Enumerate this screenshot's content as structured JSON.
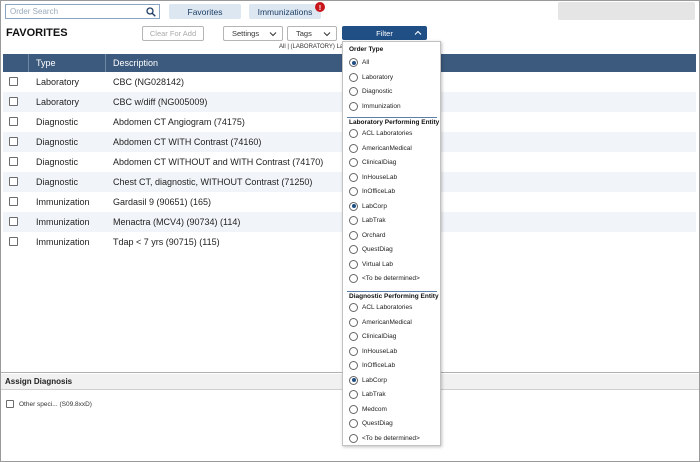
{
  "search": {
    "placeholder": "Order Search"
  },
  "tabs": [
    {
      "label": "Favorites"
    },
    {
      "label": "Immunizations",
      "badge": "!"
    }
  ],
  "page_title": "FAVORITES",
  "toolbar": {
    "clear_label": "Clear For Add",
    "settings_label": "Settings",
    "tags_label": "Tags",
    "filter_label": "Filter",
    "filter_summary": "All | (LABORATORY) La"
  },
  "table": {
    "columns": [
      "Type",
      "Description"
    ],
    "rows": [
      {
        "type": "Laboratory",
        "description": "CBC (NG028142)"
      },
      {
        "type": "Laboratory",
        "description": "CBC w/diff (NG005009)"
      },
      {
        "type": "Diagnostic",
        "description": "Abdomen CT Angiogram (74175)"
      },
      {
        "type": "Diagnostic",
        "description": "Abdomen CT WITH Contrast (74160)"
      },
      {
        "type": "Diagnostic",
        "description": "Abdomen CT WITHOUT and WITH Contrast (74170)"
      },
      {
        "type": "Diagnostic",
        "description": "Chest CT, diagnostic, WITHOUT Contrast (71250)"
      },
      {
        "type": "Immunization",
        "description": "Gardasil 9 (90651) (165)"
      },
      {
        "type": "Immunization",
        "description": "Menactra (MCV4) (90734) (114)"
      },
      {
        "type": "Immunization",
        "description": "Tdap < 7 yrs (90715) (115)"
      }
    ]
  },
  "assign_diagnosis": {
    "title": "Assign Diagnosis",
    "item": "Other speci... (S09.8xxD)"
  },
  "filter_panel": {
    "order_type": {
      "title": "Order Type",
      "options": [
        "All",
        "Laboratory",
        "Diagnostic",
        "Immunization"
      ],
      "selected": "All"
    },
    "lab_entity": {
      "title": "Laboratory Performing Entity",
      "options": [
        "ACL Laboratories",
        "AmericanMedical",
        "ClinicalDiag",
        "InHouseLab",
        "InOfficeLab",
        "LabCorp",
        "LabTrak",
        "Orchard",
        "QuestDiag",
        "Virtual Lab",
        "<To be determined>"
      ],
      "selected": "LabCorp"
    },
    "diag_entity": {
      "title": "Diagnostic Performing Entity",
      "options": [
        "ACL Laboratories",
        "AmericanMedical",
        "ClinicalDiag",
        "InHouseLab",
        "InOfficeLab",
        "LabCorp",
        "LabTrak",
        "Medcom",
        "QuestDiag",
        "<To be determined>"
      ],
      "selected": "LabCorp"
    }
  },
  "colors": {
    "header_blue": "#3c5a7d",
    "filter_blue": "#1f4f84",
    "tab_bg": "#dde7f1",
    "badge_red": "#c8161d"
  }
}
